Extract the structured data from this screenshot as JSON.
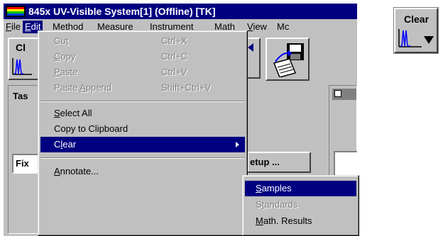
{
  "window": {
    "title": "845x UV-Visible System[1] (Offline) [TK]"
  },
  "menubar": {
    "items": [
      {
        "pre": "",
        "u": "F",
        "post": "ile"
      },
      {
        "pre": "",
        "u": "E",
        "post": "dit"
      },
      {
        "pre": "",
        "u": "M",
        "post": "ethod"
      },
      {
        "pre": "Mea",
        "u": "s",
        "post": "ure"
      },
      {
        "pre": "",
        "u": "I",
        "post": "nstrument"
      },
      {
        "pre": "M",
        "u": "a",
        "post": "th"
      },
      {
        "pre": "",
        "u": "V",
        "post": "iew"
      },
      {
        "pre": "Mc",
        "u": "",
        "post": ""
      }
    ]
  },
  "edit_menu": {
    "items": [
      {
        "pre": "Cu",
        "u": "t",
        "post": "",
        "shortcut": "Ctrl+X"
      },
      {
        "pre": "",
        "u": "C",
        "post": "opy",
        "shortcut": "Ctrl+C"
      },
      {
        "pre": "",
        "u": "P",
        "post": "aste",
        "shortcut": "Ctrl+V"
      },
      {
        "pre": "Paste ",
        "u": "A",
        "post": "ppend",
        "shortcut": "Shift+Ctrl+V"
      },
      {
        "pre": "",
        "u": "S",
        "post": "elect All",
        "shortcut": ""
      },
      {
        "pre": "Copy to Clipboard",
        "u": "",
        "post": "",
        "shortcut": ""
      },
      {
        "pre": "C",
        "u": "l",
        "post": "ear",
        "shortcut": ""
      },
      {
        "pre": "",
        "u": "A",
        "post": "nnotate...",
        "shortcut": ""
      }
    ]
  },
  "clear_submenu": {
    "items": [
      {
        "pre": "",
        "u": "S",
        "post": "amples"
      },
      {
        "pre": "S",
        "u": "t",
        "post": "andards"
      },
      {
        "pre": "",
        "u": "M",
        "post": "ath. Results"
      }
    ]
  },
  "background": {
    "toolbar_button_partial": "Cl",
    "tasks_label_partial": "Tas",
    "task_select_partial": "Fix",
    "setup_button_partial": "etup ..."
  },
  "clear_button": {
    "label": "Clear"
  },
  "colors": {
    "titlebar": "#000080",
    "selection": "#000080",
    "face": "#c0c0c0",
    "disabled_text": "#808080"
  },
  "icons": [
    "app-spectrum-icon",
    "spectrum-icon",
    "save-disk-icon",
    "dropdown-arrow-icon",
    "submenu-arrow-icon"
  ]
}
